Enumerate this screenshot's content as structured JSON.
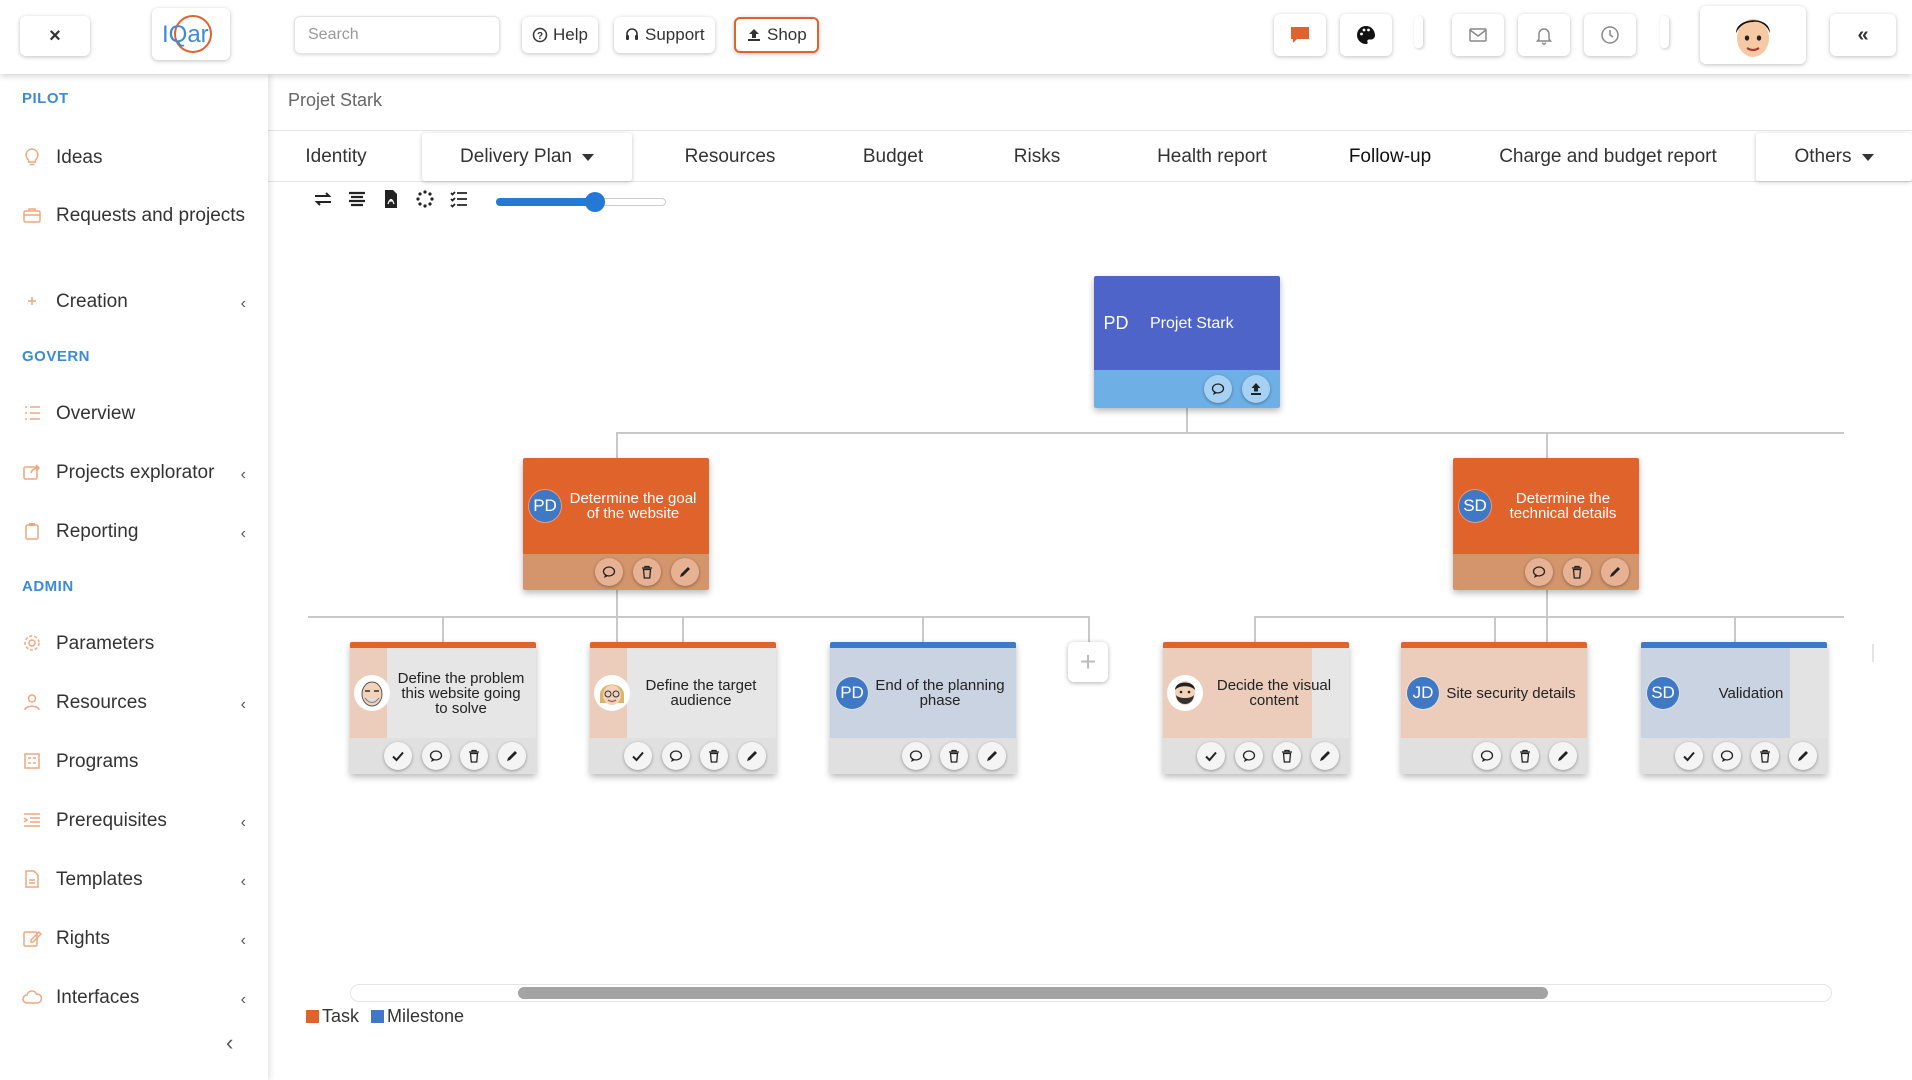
{
  "topbar": {
    "close_label": "×",
    "logo_text": "IQar",
    "search_placeholder": "Search",
    "help_label": "Help",
    "support_label": "Support",
    "shop_label": "Shop",
    "collapse_label": "«"
  },
  "sidebar": {
    "sections": {
      "pilot": "PILOT",
      "govern": "GOVERN",
      "admin": "ADMIN"
    },
    "items": [
      {
        "label": "Ideas",
        "icon": "lightbulb-icon"
      },
      {
        "label": "Requests and projects",
        "icon": "briefcase-icon"
      },
      {
        "label": "Creation",
        "icon": "plus-icon",
        "chevron": "‹"
      },
      {
        "label": "Overview",
        "icon": "list-icon"
      },
      {
        "label": "Projects explorator",
        "icon": "share-icon",
        "chevron": "‹"
      },
      {
        "label": "Reporting",
        "icon": "clipboard-icon",
        "chevron": "‹"
      },
      {
        "label": "Parameters",
        "icon": "gear-icon"
      },
      {
        "label": "Resources",
        "icon": "user-icon",
        "chevron": "‹"
      },
      {
        "label": "Programs",
        "icon": "grid-icon"
      },
      {
        "label": "Prerequisites",
        "icon": "list-indent-icon",
        "chevron": "‹"
      },
      {
        "label": "Templates",
        "icon": "file-icon",
        "chevron": "‹"
      },
      {
        "label": "Rights",
        "icon": "edit-icon",
        "chevron": "‹"
      },
      {
        "label": "Interfaces",
        "icon": "cloud-icon",
        "chevron": "‹"
      }
    ],
    "collapse_label": "‹"
  },
  "main": {
    "breadcrumb": "Projet Stark",
    "tabs": [
      {
        "label": "Identity"
      },
      {
        "label": "Delivery Plan"
      },
      {
        "label": "Resources"
      },
      {
        "label": "Budget"
      },
      {
        "label": "Risks"
      },
      {
        "label": "Health report"
      },
      {
        "label": "Follow-up"
      },
      {
        "label": "Charge and budget report"
      },
      {
        "label": "Others"
      }
    ],
    "zoom_slider_value": 0.58
  },
  "org": {
    "root": {
      "initials": "PD",
      "title": "Projet Stark"
    },
    "level1": [
      {
        "initials": "PD",
        "title": "Determine the goal of the website"
      },
      {
        "initials": "SD",
        "title": "Determine the technical details"
      }
    ],
    "level2": [
      {
        "title": "Define the problem this website going to solve",
        "assignee": "avatar-bald-man",
        "type": "task"
      },
      {
        "title": "Define the target audience",
        "assignee": "avatar-woman-glasses",
        "type": "task"
      },
      {
        "initials": "PD",
        "title": "End of the planning phase",
        "type": "milestone"
      },
      {
        "title": "Decide the visual content",
        "assignee": "avatar-bearded-man",
        "type": "task"
      },
      {
        "initials": "JD",
        "title": "Site security details",
        "type": "task"
      },
      {
        "initials": "SD",
        "title": "Validation",
        "type": "milestone"
      }
    ],
    "add_label": "+"
  },
  "legend": {
    "task_label": "Task",
    "milestone_label": "Milestone",
    "task_color": "#e0632c",
    "milestone_color": "#3f78c4"
  },
  "colors": {
    "accent": "#e0622c",
    "section_blue": "#3d8bd4",
    "root_blue": "#4e64c8",
    "slider_blue": "#2479d6"
  }
}
